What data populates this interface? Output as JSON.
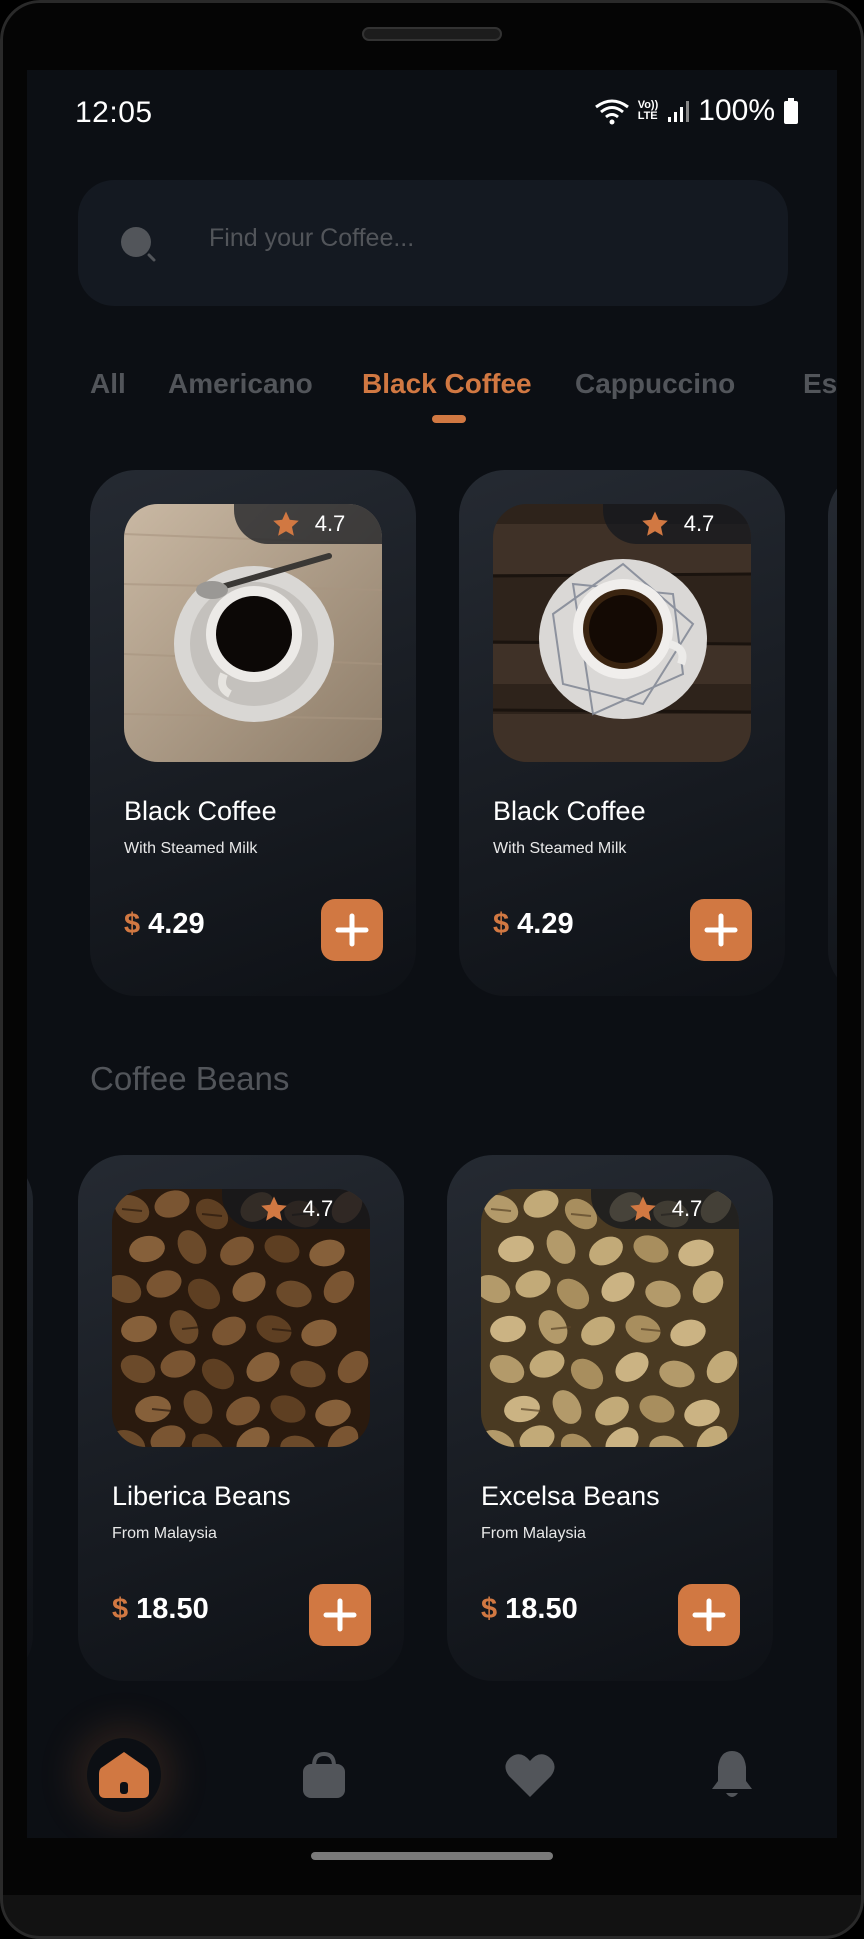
{
  "status_bar": {
    "time": "12:05",
    "network_label_top": "Vo))",
    "network_label_bottom": "LTE",
    "battery": "100%"
  },
  "search": {
    "placeholder": "Find your Coffee..."
  },
  "categories": {
    "items": [
      "All",
      "Americano",
      "Black Coffee",
      "Cappuccino",
      "Esp"
    ],
    "active": "Black Coffee"
  },
  "coffee_cards": [
    {
      "name": "Black Coffee",
      "subtitle": "With Steamed Milk",
      "currency": "$",
      "price": "4.29",
      "rating": "4.7"
    },
    {
      "name": "Black Coffee",
      "subtitle": "With Steamed Milk",
      "currency": "$",
      "price": "4.29",
      "rating": "4.7"
    }
  ],
  "beans_section": {
    "title": "Coffee Beans",
    "cards": [
      {
        "name": "Liberica Beans",
        "subtitle": "From Malaysia",
        "currency": "$",
        "price": "18.50",
        "rating": "4.7"
      },
      {
        "name": "Excelsa Beans",
        "subtitle": "From Malaysia",
        "currency": "$",
        "price": "18.50",
        "rating": "4.7"
      }
    ]
  },
  "bottom_nav": {
    "items": [
      "home-icon",
      "bag-icon",
      "heart-icon",
      "bell-icon"
    ],
    "active": "home-icon"
  },
  "colors": {
    "accent": "#D17842",
    "background": "#0C0F14",
    "card": "#252A32",
    "muted_text": "#52555A"
  }
}
